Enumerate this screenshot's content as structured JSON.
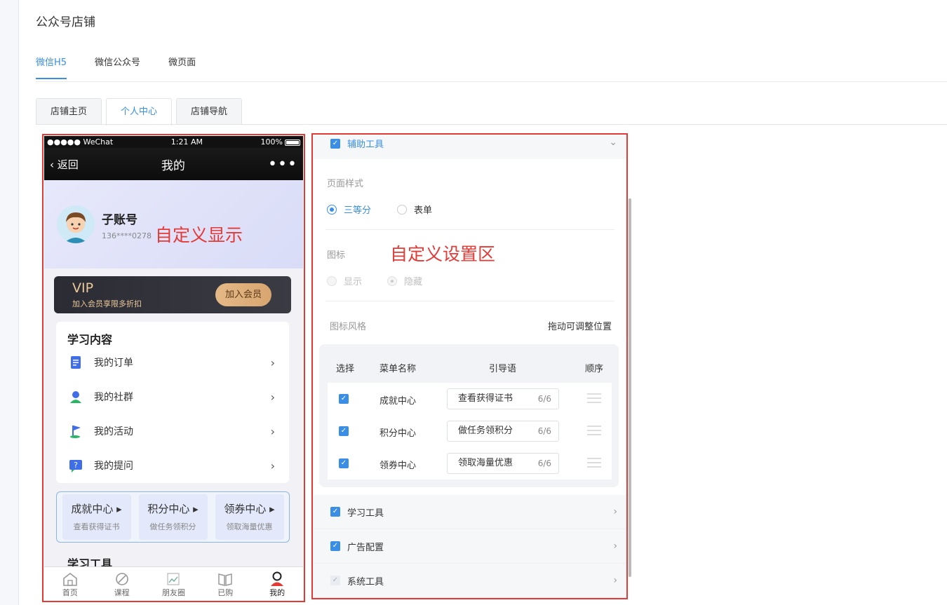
{
  "page_title": "公众号店铺",
  "top_tabs": [
    "微信H5",
    "微信公众号",
    "微页面"
  ],
  "sub_tabs": [
    "店铺主页",
    "个人中心",
    "店铺导航"
  ],
  "phone": {
    "status": {
      "carrier": "●●●●● WeChat",
      "time": "1:21 AM",
      "battery": "100%"
    },
    "nav": {
      "back": "返回",
      "title": "我的",
      "more": "•••"
    },
    "profile": {
      "name": "子账号",
      "phone": "136****0278"
    },
    "vip": {
      "title": "VIP",
      "subtitle": "加入会员享限多折扣",
      "button": "加入会员"
    },
    "study": {
      "heading": "学习内容",
      "items": [
        {
          "label": "我的订单",
          "icon": "order-icon"
        },
        {
          "label": "我的社群",
          "icon": "community-icon"
        },
        {
          "label": "我的活动",
          "icon": "flag-icon"
        },
        {
          "label": "我的提问",
          "icon": "question-icon"
        }
      ]
    },
    "centers": [
      {
        "title": "成就中心 ▸",
        "sub": "查看获得证书"
      },
      {
        "title": "积分中心 ▸",
        "sub": "做任务领积分"
      },
      {
        "title": "领券中心 ▸",
        "sub": "领取海量优惠"
      }
    ],
    "tools_heading": "学习工具",
    "tabbar": [
      "首页",
      "课程",
      "朋友圈",
      "已购",
      "我的"
    ]
  },
  "annotations": {
    "left": "自定义显示",
    "right": "自定义设置区"
  },
  "panel": {
    "aux_tools": "辅助工具",
    "page_style_label": "页面样式",
    "page_style_options": [
      "三等分",
      "表单"
    ],
    "icon_label": "图标",
    "icon_options": [
      "显示",
      "隐藏"
    ],
    "icon_style_label": "图标风格",
    "drag_hint": "拖动可调整位置",
    "table_headers": [
      "选择",
      "菜单名称",
      "引导语",
      "顺序"
    ],
    "rows": [
      {
        "name": "成就中心",
        "guide": "查看获得证书",
        "count": "6/6"
      },
      {
        "name": "积分中心",
        "guide": "做任务领积分",
        "count": "6/6"
      },
      {
        "name": "领券中心",
        "guide": "领取海量优惠",
        "count": "6/6"
      }
    ],
    "sections": [
      "学习工具",
      "广告配置",
      "系统工具"
    ]
  },
  "colors": {
    "accent": "#3a8ee6",
    "annotation": "#e53935"
  }
}
